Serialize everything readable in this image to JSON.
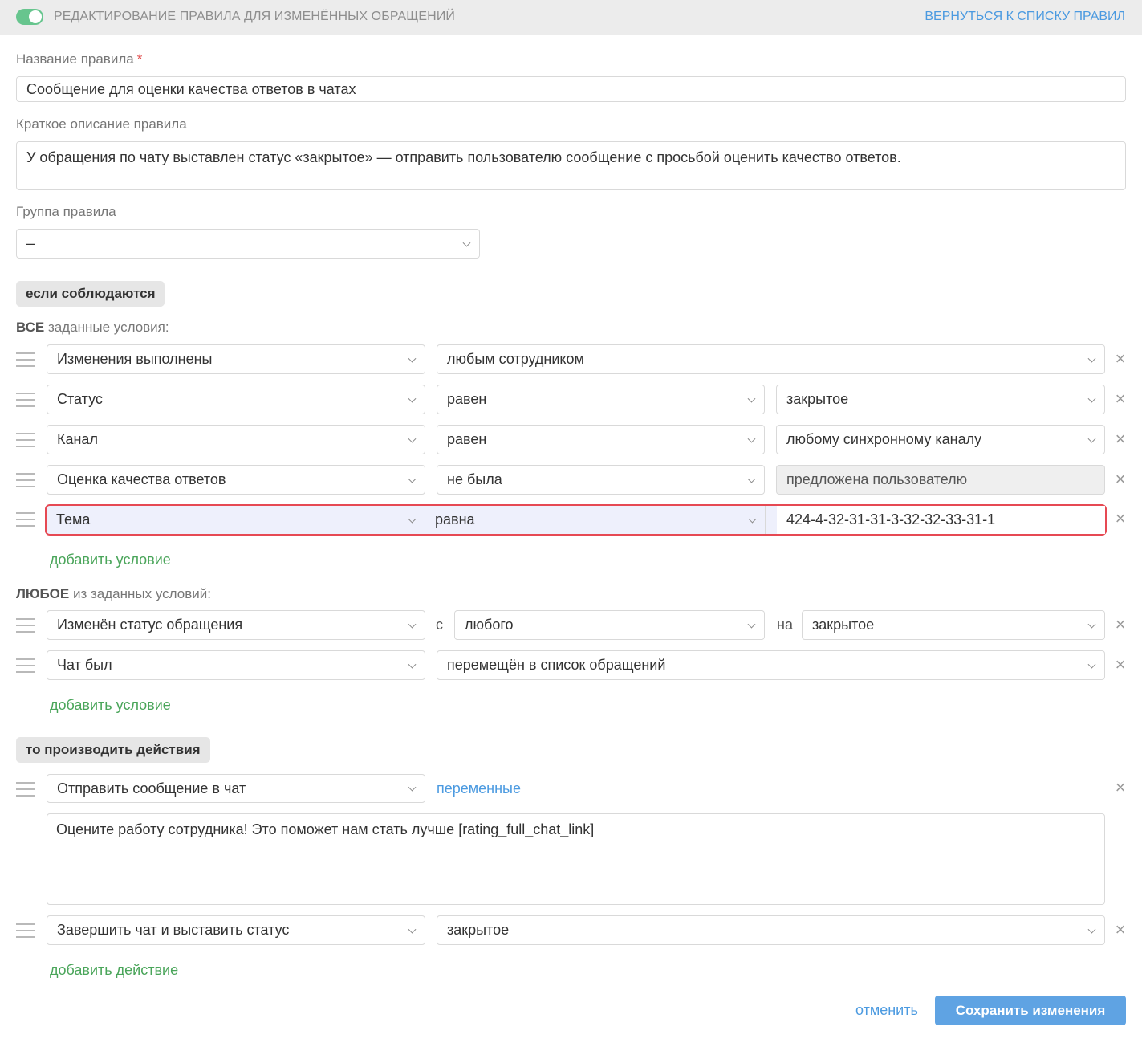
{
  "header": {
    "title": "РЕДАКТИРОВАНИЕ ПРАВИЛА ДЛЯ ИЗМЕНЁННЫХ ОБРАЩЕНИЙ",
    "back_link": "ВЕРНУТЬСЯ К СПИСКУ ПРАВИЛ",
    "toggle_on": true
  },
  "form": {
    "name_label": "Название правила",
    "required_mark": "*",
    "name_value": "Сообщение для оценки качества ответов в чатах",
    "desc_label": "Краткое описание правила",
    "desc_value": "У обращения по чату выставлен статус «закрытое» — отправить пользователю сообщение с просьбой оценить качество ответов.",
    "group_label": "Группа правила",
    "group_value": "–"
  },
  "conditions": {
    "chip": "если соблюдаются",
    "all": {
      "hint_bold": "ВСЕ",
      "hint_rest": " заданные условия:",
      "rows": [
        {
          "field": "Изменения выполнены",
          "op": "любым сотрудником"
        },
        {
          "field": "Статус",
          "op": "равен",
          "value": "закрытое"
        },
        {
          "field": "Канал",
          "op": "равен",
          "value": "любому синхронному каналу"
        },
        {
          "field": "Оценка качества ответов",
          "op": "не была",
          "value": "предложена пользователю"
        },
        {
          "field": "Тема",
          "op": "равна",
          "value": "424-4-32-31-31-3-32-32-33-31-1"
        }
      ],
      "add": "добавить условие"
    },
    "any": {
      "hint_bold": "ЛЮБОЕ",
      "hint_rest": " из заданных условий:",
      "row1": {
        "field": "Изменён статус обращения",
        "from_word": "с",
        "from": "любого",
        "to_word": "на",
        "to": "закрытое"
      },
      "row2": {
        "field": "Чат был",
        "op": "перемещён в список обращений"
      },
      "add": "добавить условие"
    }
  },
  "actions": {
    "chip": "то производить действия",
    "row1": {
      "action": "Отправить сообщение в чат",
      "vars_link": "переменные",
      "message": "Оцените работу сотрудника! Это поможет нам стать лучше [rating_full_chat_link]"
    },
    "row2": {
      "action": "Завершить чат и выставить статус",
      "value": "закрытое"
    },
    "add": "добавить действие"
  },
  "footer": {
    "cancel": "отменить",
    "save": "Сохранить изменения"
  },
  "icons": {
    "remove": "close-icon",
    "drag": "drag-handle-icon",
    "dropdown": "chevron-down-icon"
  },
  "colors": {
    "accent": "#4b9ae0",
    "green": "#4aa55a",
    "highlight": "#e64953",
    "toggle": "#67c58e"
  }
}
